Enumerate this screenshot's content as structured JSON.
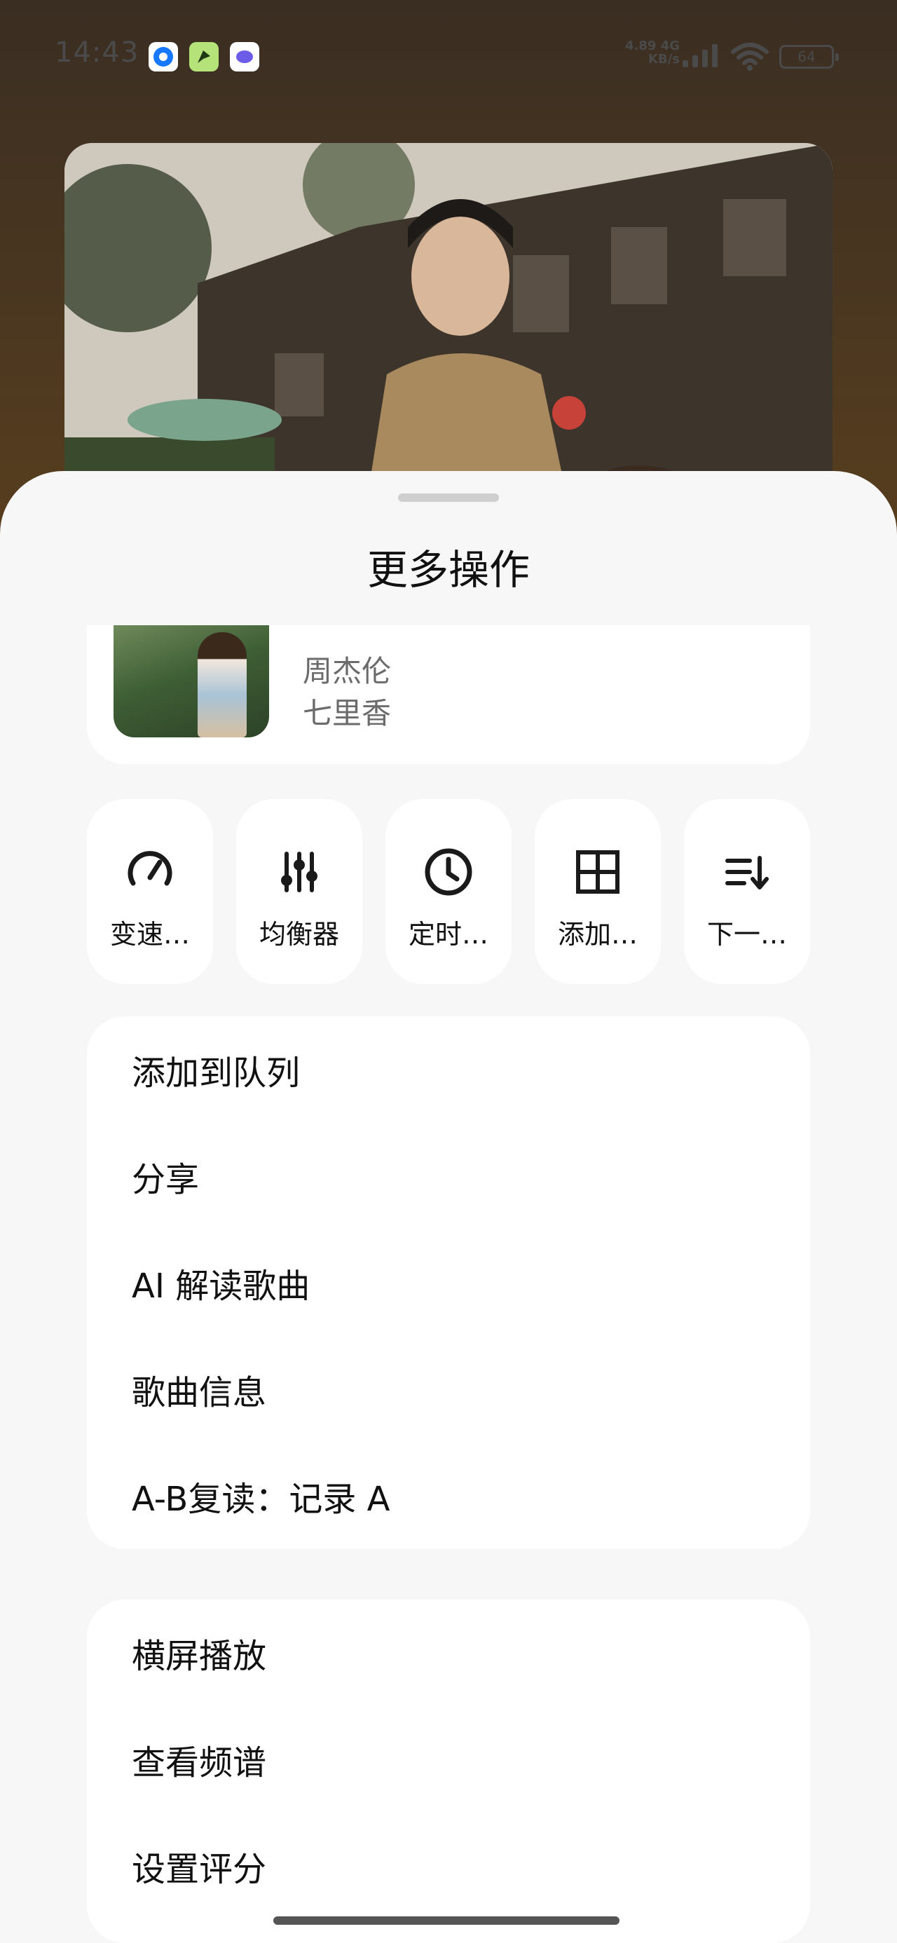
{
  "status_bar": {
    "time": "14:43",
    "net_speed_value": "4.89",
    "net_speed_unit": "KB/s",
    "network_type": "4G",
    "battery": "64",
    "app_icons": [
      "pay-app-icon",
      "green-app-icon",
      "chat-app-icon"
    ]
  },
  "sheet": {
    "title": "更多操作"
  },
  "song": {
    "artist": "周杰伦",
    "album": "七里香"
  },
  "quick_actions": [
    {
      "label": "变速…",
      "icon": "speed-gauge-icon"
    },
    {
      "label": "均衡器",
      "icon": "equalizer-icon"
    },
    {
      "label": "定时…",
      "icon": "timer-clock-icon"
    },
    {
      "label": "添加…",
      "icon": "add-grid-icon"
    },
    {
      "label": "下一…",
      "icon": "play-next-icon"
    }
  ],
  "menu_group_1": [
    {
      "label": "添加到队列"
    },
    {
      "label": "分享"
    },
    {
      "label": "AI 解读歌曲"
    },
    {
      "label": "歌曲信息"
    },
    {
      "label": "A-B复读：记录 A"
    }
  ],
  "menu_group_2": [
    {
      "label": "横屏播放"
    },
    {
      "label": "查看频谱"
    },
    {
      "label": "设置评分"
    }
  ],
  "colors": {
    "sheet_background": "#f7f7f7",
    "card_background": "#ffffff",
    "text_primary": "#111111",
    "text_secondary": "#6b6b6b"
  }
}
